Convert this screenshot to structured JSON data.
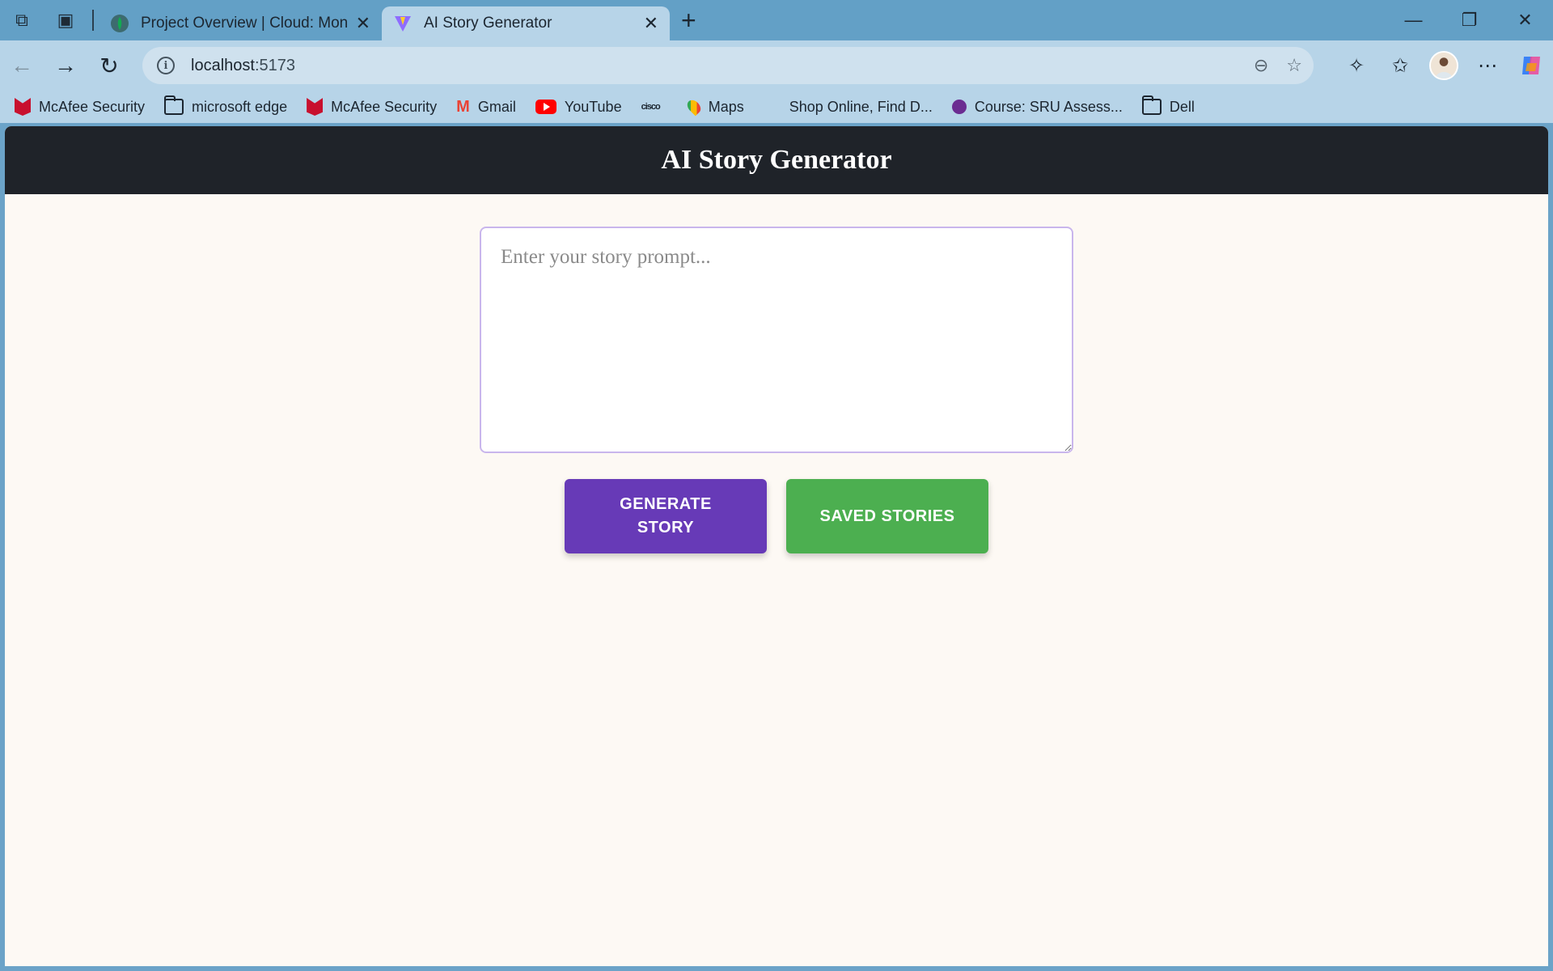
{
  "browser": {
    "tabs": [
      {
        "title": "Project Overview | Cloud: MongoDB Cloud",
        "active": false
      },
      {
        "title": "AI Story Generator",
        "active": true
      }
    ],
    "url_host": "localhost",
    "url_port": ":5173",
    "bookmarks": [
      {
        "label": "McAfee Security",
        "icon": "mcafee-icon"
      },
      {
        "label": "microsoft edge",
        "icon": "folder-icon"
      },
      {
        "label": "McAfee Security",
        "icon": "mcafee-icon"
      },
      {
        "label": "Gmail",
        "icon": "gmail-icon"
      },
      {
        "label": "YouTube",
        "icon": "youtube-icon"
      },
      {
        "label": "",
        "icon": "cisco-icon"
      },
      {
        "label": "Maps",
        "icon": "maps-icon"
      },
      {
        "label": "Shop Online, Find D...",
        "icon": "microsoft-icon"
      },
      {
        "label": "Course: SRU Assess...",
        "icon": "course-icon"
      },
      {
        "label": "Dell",
        "icon": "folder-icon"
      }
    ],
    "cisco_text": "cisco"
  },
  "app": {
    "title": "AI Story Generator",
    "prompt_placeholder": "Enter your story prompt...",
    "prompt_value": "",
    "generate_label": "GENERATE STORY",
    "saved_label": "SAVED STORIES"
  },
  "colors": {
    "header_bg": "#1f2329",
    "page_bg": "#fdf9f4",
    "generate_btn": "#673ab7",
    "saved_btn": "#4caf50",
    "textarea_border": "#c9b6ec"
  }
}
